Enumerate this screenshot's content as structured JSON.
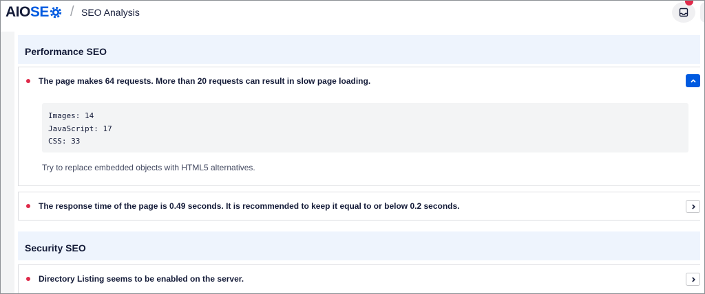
{
  "header": {
    "logo_aio": "AIO",
    "logo_seo": "SE",
    "separator": "/",
    "title": "SEO Analysis"
  },
  "sections": {
    "performance": {
      "title": "Performance SEO",
      "requests_issue": {
        "text": "The page makes 64 requests. More than 20 requests can result in slow page loading.",
        "details": [
          "Images: 14",
          "JavaScript: 17",
          "CSS: 33"
        ],
        "hint": "Try to replace embedded objects with HTML5 alternatives.",
        "expanded": true
      },
      "response_issue": {
        "text": "The response time of the page is 0.49 seconds. It is recommended to keep it equal to or below 0.2 seconds.",
        "expanded": false
      }
    },
    "security": {
      "title": "Security SEO",
      "directory_issue": {
        "text": "Directory Listing seems to be enabled on the server.",
        "expanded": false
      }
    }
  },
  "colors": {
    "accent": "#005ae0",
    "error": "#df2a4a",
    "section_bg": "#eef4fd"
  },
  "icons": {
    "notifications": "inbox-icon",
    "expanded_toggle": "chevron-up-icon",
    "collapsed_toggle": "chevron-right-icon"
  }
}
